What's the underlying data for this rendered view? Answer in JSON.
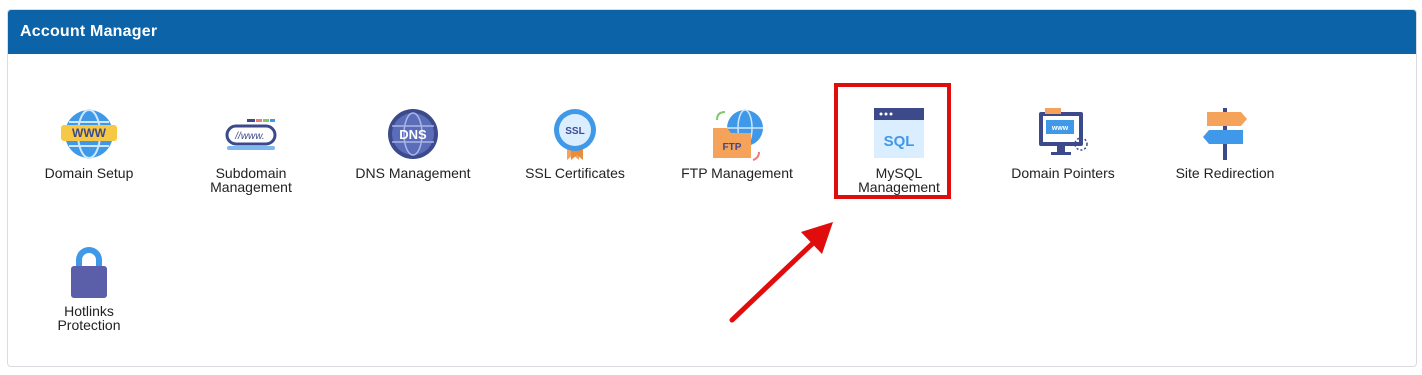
{
  "panel": {
    "title": "Account Manager"
  },
  "tiles": [
    {
      "name": "domain-setup",
      "label": "Domain Setup",
      "icon": "globe-www-icon"
    },
    {
      "name": "subdomain-management",
      "label": "Subdomain\nManagement",
      "icon": "subdomain-address-bar-icon"
    },
    {
      "name": "dns-management",
      "label": "DNS Management",
      "icon": "dns-globe-icon"
    },
    {
      "name": "ssl-certificates",
      "label": "SSL Certificates",
      "icon": "ssl-badge-icon"
    },
    {
      "name": "ftp-management",
      "label": "FTP Management",
      "icon": "ftp-folder-icon"
    },
    {
      "name": "mysql-management",
      "label": "MySQL\nManagement",
      "icon": "sql-window-icon"
    },
    {
      "name": "domain-pointers",
      "label": "Domain Pointers",
      "icon": "monitor-www-icon"
    },
    {
      "name": "site-redirection",
      "label": "Site Redirection",
      "icon": "signpost-icon"
    },
    {
      "name": "hotlinks-protection",
      "label": "Hotlinks\nProtection",
      "icon": "padlock-icon"
    }
  ],
  "colors": {
    "header_bg": "#0c63a8",
    "highlight": "#e10c0c",
    "icon_blue": "#3f99e8",
    "icon_navy": "#3c4a8c",
    "icon_orange": "#f5a35a"
  }
}
